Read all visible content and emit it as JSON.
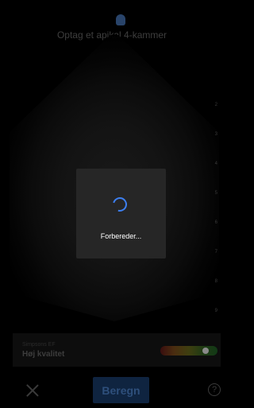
{
  "header": {
    "title": "Optag et apikal 4-kammer",
    "profile_icon": "person-icon"
  },
  "scan": {
    "depth_labels": [
      "2",
      "3",
      "4",
      "5",
      "6",
      "7",
      "8",
      "9",
      "10"
    ]
  },
  "quality": {
    "label": "Simpsons EF",
    "value": "Høj kvalitet",
    "level": 0.85,
    "colors": [
      "#3a0e0e",
      "#4a2e10",
      "#3f3f10",
      "#1f3b14",
      "#123a16"
    ]
  },
  "controls": {
    "close_icon": "close-icon",
    "calculate_label": "Beregn",
    "help_label": "?",
    "help_icon": "help-icon"
  },
  "loading": {
    "text": "Forbereder...",
    "spinner_color": "#3d7ff0"
  }
}
